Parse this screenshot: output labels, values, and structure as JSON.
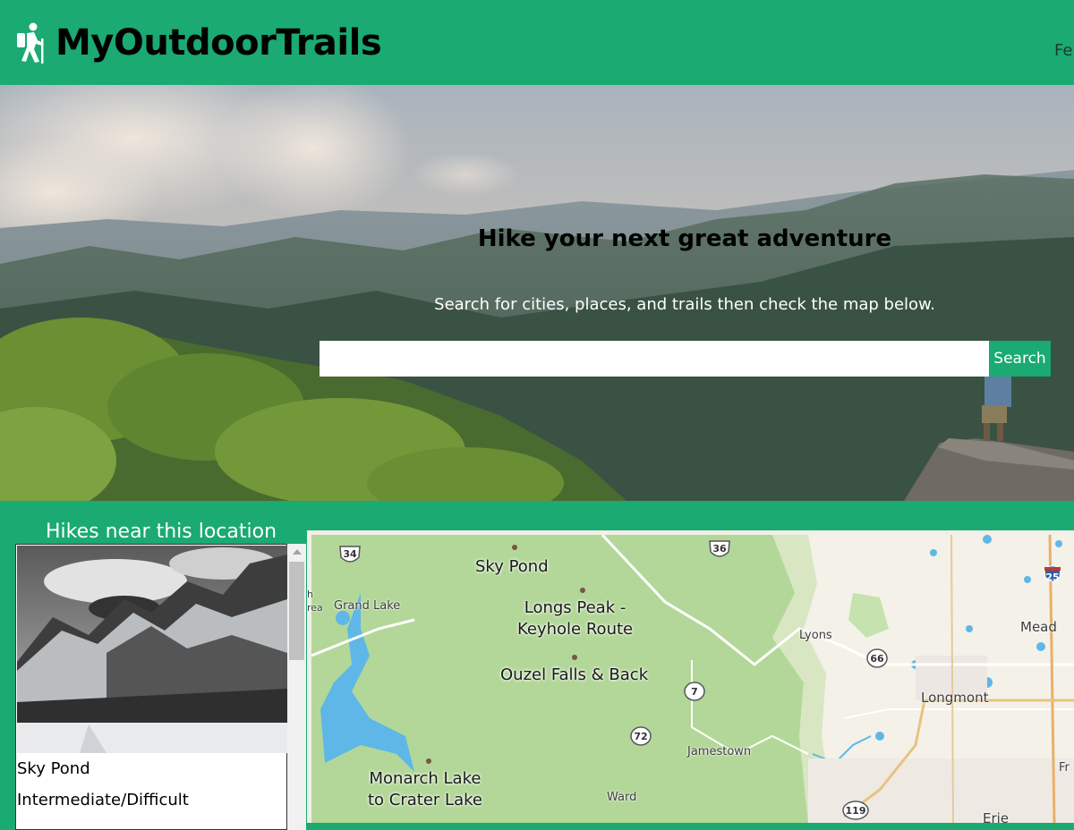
{
  "header": {
    "brand": "MyOutdoorTrails",
    "logo_icon": "hiker-icon",
    "nav_items": [
      "Fe"
    ]
  },
  "hero": {
    "title": "Hike your next great adventure",
    "subtitle": "Search for cities, places, and trails then check the map below.",
    "search_value": "",
    "search_placeholder": "",
    "search_button_label": "Search"
  },
  "hikes": {
    "heading": "Hikes near this location",
    "items": [
      {
        "name": "Sky Pond",
        "difficulty": "Intermediate/Difficult"
      }
    ]
  },
  "map": {
    "trails": [
      "Sky Pond",
      "Longs Peak -\nKeyhole Route",
      "Ouzel Falls & Back",
      "Monarch Lake\nto Crater Lake"
    ],
    "towns": [
      "Grand Lake",
      "Lyons",
      "Mead",
      "Longmont",
      "Jamestown",
      "Ward",
      "Erie",
      "Fr",
      "h",
      "rea"
    ],
    "route_shields": [
      "34",
      "36",
      "25",
      "66",
      "7",
      "72",
      "119"
    ]
  },
  "colors": {
    "brand_green": "#1aaa72",
    "map_park_green": "#b9dca0",
    "map_water": "#5fb7e8"
  }
}
